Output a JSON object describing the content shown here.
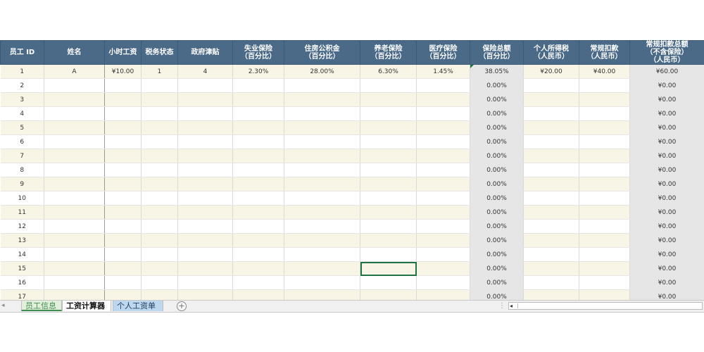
{
  "columns": [
    {
      "key": "id",
      "label": "员工 ID"
    },
    {
      "key": "name",
      "label": "姓名"
    },
    {
      "key": "wage",
      "label": "小时工资"
    },
    {
      "key": "tax",
      "label": "税务状态"
    },
    {
      "key": "allow",
      "label": "政府津贴"
    },
    {
      "key": "unemp",
      "label": "失业保险\n（百分比）"
    },
    {
      "key": "housing",
      "label": "住房公积金\n（百分比）"
    },
    {
      "key": "pension",
      "label": "养老保险\n（百分比）"
    },
    {
      "key": "medical",
      "label": "医疗保险\n（百分比）"
    },
    {
      "key": "instotal",
      "label": "保险总额\n（百分比）"
    },
    {
      "key": "itax",
      "label": "个人所得税\n（人民币）"
    },
    {
      "key": "deduct",
      "label": "常规扣款\n（人民币）"
    },
    {
      "key": "dedtotal",
      "label": "常规扣款总额\n（不含保险）\n（人民币）"
    }
  ],
  "rows": [
    {
      "id": "1",
      "name": "A",
      "wage": "¥10.00",
      "tax": "1",
      "allow": "4",
      "unemp": "2.30%",
      "housing": "28.00%",
      "pension": "6.30%",
      "medical": "1.45%",
      "instotal": "38.05%",
      "itax": "¥20.00",
      "deduct": "¥40.00",
      "dedtotal": "¥60.00"
    },
    {
      "id": "2",
      "instotal": "0.00%",
      "dedtotal": "¥0.00"
    },
    {
      "id": "3",
      "instotal": "0.00%",
      "dedtotal": "¥0.00"
    },
    {
      "id": "4",
      "instotal": "0.00%",
      "dedtotal": "¥0.00"
    },
    {
      "id": "5",
      "instotal": "0.00%",
      "dedtotal": "¥0.00"
    },
    {
      "id": "6",
      "instotal": "0.00%",
      "dedtotal": "¥0.00"
    },
    {
      "id": "7",
      "instotal": "0.00%",
      "dedtotal": "¥0.00"
    },
    {
      "id": "8",
      "instotal": "0.00%",
      "dedtotal": "¥0.00"
    },
    {
      "id": "9",
      "instotal": "0.00%",
      "dedtotal": "¥0.00"
    },
    {
      "id": "10",
      "instotal": "0.00%",
      "dedtotal": "¥0.00"
    },
    {
      "id": "11",
      "instotal": "0.00%",
      "dedtotal": "¥0.00"
    },
    {
      "id": "12",
      "instotal": "0.00%",
      "dedtotal": "¥0.00"
    },
    {
      "id": "13",
      "instotal": "0.00%",
      "dedtotal": "¥0.00"
    },
    {
      "id": "14",
      "instotal": "0.00%",
      "dedtotal": "¥0.00"
    },
    {
      "id": "15",
      "instotal": "0.00%",
      "dedtotal": "¥0.00"
    },
    {
      "id": "16",
      "instotal": "0.00%",
      "dedtotal": "¥0.00"
    },
    {
      "id": "17",
      "instotal": "0.00%",
      "dedtotal": "¥0.00"
    }
  ],
  "sheet_tabs": [
    {
      "label": "员工信息"
    },
    {
      "label": "工资计算器"
    },
    {
      "label": "个人工资单"
    }
  ],
  "active_tab": "工资计算器",
  "icons": {
    "add_sheet": "plus-circle-icon",
    "scroll_left": "triangle-left-icon"
  },
  "colors": {
    "header_bg": "#4b6a88",
    "band_row": "#f8f4e6",
    "calc_col": "#e6e6e6",
    "selection": "#1f7244"
  }
}
